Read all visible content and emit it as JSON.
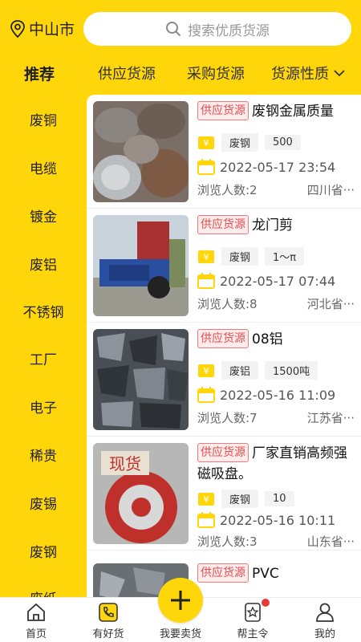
{
  "colors": {
    "brand": "#FFD60A",
    "badge": "#E84B4B",
    "notice": "#E53935"
  },
  "header": {
    "city": "中山市",
    "search_placeholder": "搜索优质货源"
  },
  "tabs": {
    "recommend": "推荐",
    "supply": "供应货源",
    "purchase": "采购货源",
    "nature": "货源性质"
  },
  "sidebar": {
    "items": [
      "废铜",
      "电缆",
      "镀金",
      "废铝",
      "不锈钢",
      "工厂",
      "电子",
      "稀贵",
      "废锡",
      "废钢",
      "废纸"
    ]
  },
  "listings": [
    {
      "badge": "供应货源",
      "title": "废钢金属质量",
      "category": "废钢",
      "qty": "500",
      "date": "2022-05-17 23:54",
      "views": "浏览人数:2",
      "region": "四川省···"
    },
    {
      "badge": "供应货源",
      "title": "龙门剪",
      "category": "废钢",
      "qty": "1～π",
      "date": "2022-05-17 07:44",
      "views": "浏览人数:8",
      "region": "河北省···"
    },
    {
      "badge": "供应货源",
      "title": "08铝",
      "category": "废铝",
      "qty": "1500吨",
      "date": "2022-05-16 11:09",
      "views": "浏览人数:7",
      "region": "江苏省···"
    },
    {
      "badge": "供应货源",
      "title": "厂家直销高频强磁吸盘。",
      "category": "废钢",
      "qty": "10",
      "date": "2022-05-16 10:11",
      "views": "浏览人数:3",
      "region": "山东省···"
    },
    {
      "badge": "供应货源",
      "title": "PVC",
      "category": "",
      "qty": "",
      "date": "",
      "views": "",
      "region": ""
    }
  ],
  "bottom_nav": {
    "home": "首页",
    "goods": "有好货",
    "sell": "我要卖货",
    "help": "帮主令",
    "mine": "我的"
  }
}
